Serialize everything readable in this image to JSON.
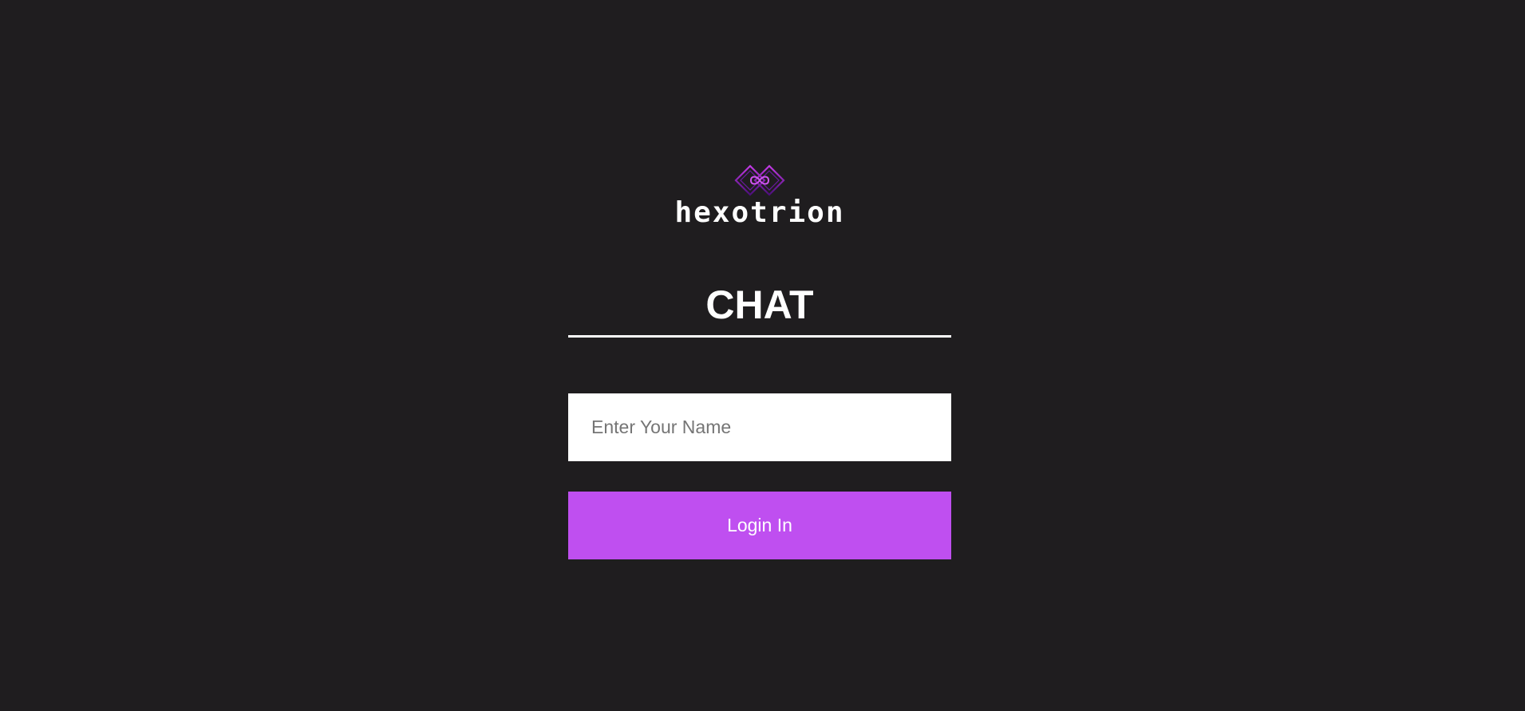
{
  "brand": {
    "name": "hexotrion",
    "logo_icon": "infinity-diamonds-icon",
    "accent_color": "#bf4ff0",
    "logo_dark_color": "#4b0f7a"
  },
  "page": {
    "title": "CHAT",
    "background_color": "#1f1d1f"
  },
  "login_form": {
    "name_placeholder": "Enter Your Name",
    "name_value": "",
    "submit_label": "Login In"
  }
}
